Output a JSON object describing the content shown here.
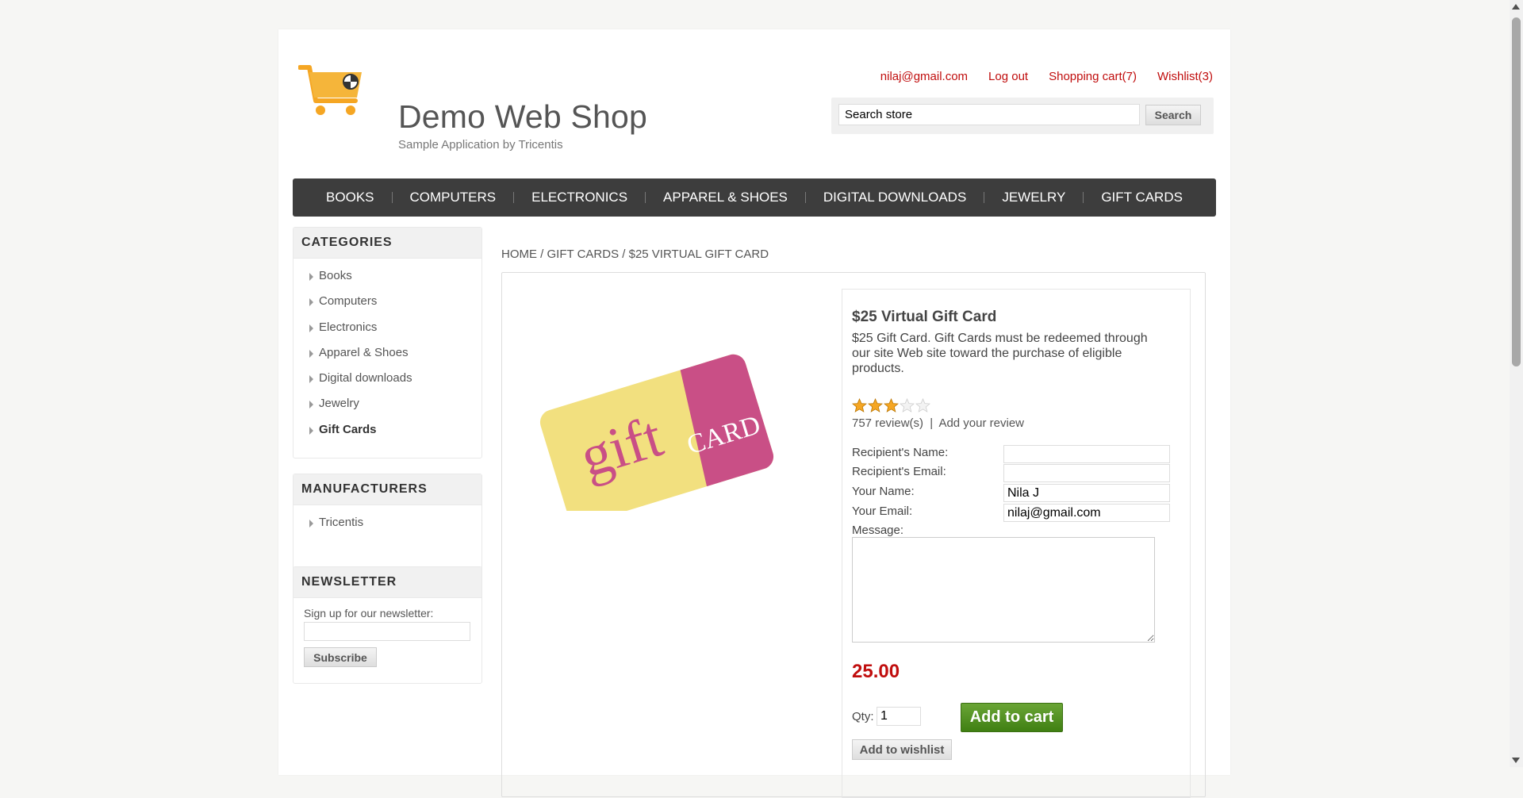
{
  "header": {
    "logo_title": "Demo Web Shop",
    "logo_subtitle": "Sample Application by Tricentis",
    "links": {
      "account": "nilaj@gmail.com",
      "logout": "Log out",
      "cart": "Shopping cart(7)",
      "wishlist": "Wishlist(3)"
    },
    "search": {
      "value": "Search store",
      "button": "Search"
    }
  },
  "nav": {
    "items": [
      "BOOKS",
      "COMPUTERS",
      "ELECTRONICS",
      "APPAREL & SHOES",
      "DIGITAL DOWNLOADS",
      "JEWELRY",
      "GIFT CARDS"
    ]
  },
  "sidebar": {
    "categories": {
      "title": "CATEGORIES",
      "items": [
        "Books",
        "Computers",
        "Electronics",
        "Apparel & Shoes",
        "Digital downloads",
        "Jewelry",
        "Gift Cards"
      ],
      "active": "Gift Cards"
    },
    "manufacturers": {
      "title": "MANUFACTURERS",
      "items": [
        "Tricentis"
      ]
    },
    "newsletter": {
      "title": "NEWSLETTER",
      "label": "Sign up for our newsletter:",
      "button": "Subscribe"
    }
  },
  "breadcrumb": {
    "home": "HOME",
    "sep": "/",
    "category": "GIFT CARDS",
    "current": "$25 VIRTUAL GIFT CARD"
  },
  "product": {
    "title": "$25 Virtual Gift Card",
    "description": "$25 Gift Card. Gift Cards must be redeemed through our site Web site toward the purchase of eligible products.",
    "rating": 3,
    "rating_max": 5,
    "reviews_text": "757 review(s)",
    "reviews_sep": "|",
    "add_review": "Add your review",
    "image_text": {
      "gift": "gift",
      "card": "CARD"
    },
    "form": {
      "recipient_name_label": "Recipient's Name:",
      "recipient_name_value": "",
      "recipient_email_label": "Recipient's Email:",
      "recipient_email_value": "",
      "your_name_label": "Your Name:",
      "your_name_value": "Nila J",
      "your_email_label": "Your Email:",
      "your_email_value": "nilaj@gmail.com",
      "message_label": "Message:"
    },
    "price": "25.00",
    "qty_label": "Qty:",
    "qty_value": "1",
    "add_to_cart": "Add to cart",
    "add_to_wishlist": "Add to wishlist"
  },
  "colors": {
    "accent_red": "#c00d0d",
    "nav_bg": "#3d3d3d",
    "cart_green": "#4f8f1f",
    "star": "#f5a623"
  }
}
